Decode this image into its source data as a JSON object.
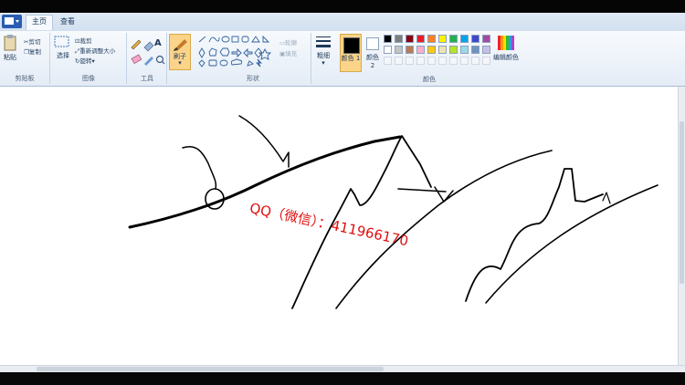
{
  "app": {
    "title_obscured": ""
  },
  "tabs": [
    {
      "label": "主页"
    },
    {
      "label": "查看"
    }
  ],
  "ribbon": {
    "clipboard": {
      "paste": "粘贴",
      "cut": "剪切",
      "copy": "复制",
      "label": "剪贴板"
    },
    "image": {
      "select": "选择",
      "crop": "裁剪",
      "resize": "重新调整大小",
      "rotate": "旋转",
      "label": "图像"
    },
    "tools": {
      "label": "工具",
      "text_icon": "A"
    },
    "brushes": {
      "label": "刷子"
    },
    "shapes": {
      "outline": "轮廓",
      "fill": "填充",
      "label": "形状"
    },
    "size": {
      "label": "粗细"
    },
    "color1": {
      "label": "颜色 1",
      "value": "#000000"
    },
    "color2": {
      "label": "颜色 2",
      "value": "#ffffff"
    },
    "edit_colors": {
      "label": "编辑颜色"
    },
    "colors_group_label": "颜色",
    "palette": [
      "#000000",
      "#7f7f7f",
      "#880015",
      "#ed1c24",
      "#ff7f27",
      "#fff200",
      "#22b14c",
      "#00a2e8",
      "#3f48cc",
      "#a349a4",
      "#ffffff",
      "#c3c3c3",
      "#b97a57",
      "#ffaec9",
      "#ffc90e",
      "#efe4b0",
      "#b5e61d",
      "#99d9ea",
      "#7092be",
      "#c8bfe7"
    ]
  },
  "canvas": {
    "watermark": "QQ（微信）：411966170",
    "watermark_color": "#e01010"
  },
  "colors": {
    "ribbon_bg": "#e4ecf6",
    "canvas_bg": "#ffffff",
    "ink": "#000000"
  }
}
